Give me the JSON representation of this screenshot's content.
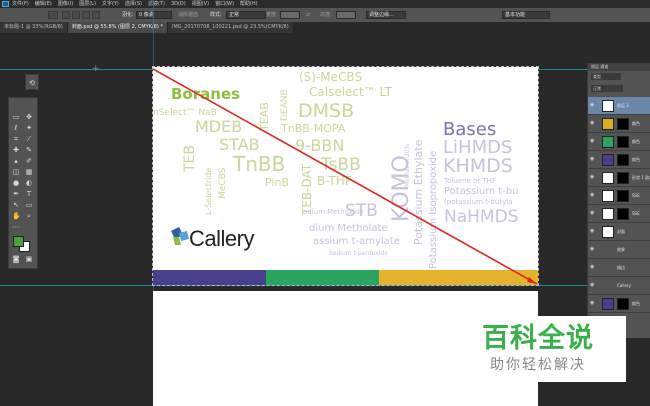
{
  "menu": {
    "items": [
      "文件(F)",
      "编辑(E)",
      "图像(I)",
      "图层(L)",
      "文字(Y)",
      "选择(S)",
      "滤镜(T)",
      "3D(D)",
      "视图(V)",
      "窗口(W)",
      "帮助(H)"
    ]
  },
  "tabs": [
    {
      "label": "未标题-1 @ 33%(RGB/8)",
      "active": false
    },
    {
      "label": "封面.psd @ 55.8% (图层 2, CMYK/8) *",
      "active": true
    },
    {
      "label": "IMG_20170708_100221.psd @ 23.5%(CMYK/8)",
      "active": false
    }
  ],
  "options": {
    "feather_label": "羽化:",
    "feather_value": "0 像素",
    "antialias_label": "消除锯齿",
    "style_label": "样式:",
    "style_value": "正常",
    "width_label": "宽度:",
    "height_label": "高度:",
    "refine_button": "调整边缘...",
    "workspace": "基本功能"
  },
  "canvas": {
    "logo_text": "Callery",
    "words": [
      {
        "text": "Boranes",
        "color": "#8cbf3f"
      },
      {
        "text": "(S)-MeCBS",
        "color": "#c8d89a"
      },
      {
        "text": "Calselect™ LT",
        "color": "#c8d89a"
      },
      {
        "text": "DMSB",
        "color": "#c8d89a"
      },
      {
        "text": "MDEB",
        "color": "#c8d89a"
      },
      {
        "text": "TnBB-MOPA",
        "color": "#c8d89a"
      },
      {
        "text": "STAB",
        "color": "#c8d89a"
      },
      {
        "text": "9-BBN",
        "color": "#c8d89a"
      },
      {
        "text": "TnBB",
        "color": "#c8d89a"
      },
      {
        "text": "TsBB",
        "color": "#c8d89a"
      },
      {
        "text": "TEB",
        "color": "#c8d89a"
      },
      {
        "text": "PinB",
        "color": "#c8d89a"
      },
      {
        "text": "B-THF",
        "color": "#c8d89a"
      },
      {
        "text": "TEAB",
        "color": "#c8d89a"
      },
      {
        "text": "DEANB",
        "color": "#c8d89a"
      },
      {
        "text": "nSelect™ NaB",
        "color": "#c8d89a"
      },
      {
        "text": "L-Selectride",
        "color": "#c8d89a"
      },
      {
        "text": "MeCBS",
        "color": "#c8d89a"
      },
      {
        "text": "TEB-DAT",
        "color": "#c8d89a"
      },
      {
        "text": "Bases",
        "color": "#7e72ad"
      },
      {
        "text": "LiHMDS",
        "color": "#c8c2dc"
      },
      {
        "text": "KHMDS",
        "color": "#c8c2dc"
      },
      {
        "text": "Toluene or THF",
        "color": "#c8c2dc"
      },
      {
        "text": "Potassium t-bu",
        "color": "#c8c2dc"
      },
      {
        "text": "(potassium t-butyla",
        "color": "#c8c2dc"
      },
      {
        "text": "NaHMDS",
        "color": "#c8c2dc"
      },
      {
        "text": "STB",
        "color": "#c8c2dc"
      },
      {
        "text": "KOMO",
        "color": "#c8c2dc"
      },
      {
        "text": "Potassium Ethylate",
        "color": "#c8c2dc"
      },
      {
        "text": "Potassium Isopropoxide",
        "color": "#c8c2dc"
      },
      {
        "text": "odium Methoxide",
        "color": "#c8c2dc"
      },
      {
        "text": "dium Metholate",
        "color": "#c8c2dc"
      },
      {
        "text": "assium t-amylate",
        "color": "#c8c2dc"
      },
      {
        "text": "Sodium t-pentoxide",
        "color": "#c8c2dc"
      },
      {
        "text": "Methanol 30%",
        "color": "#c8c2dc"
      }
    ],
    "bar_colors": [
      "#4a3f8c",
      "#2aa35f",
      "#e4b22c",
      "#e4b22c"
    ]
  },
  "layers": {
    "tabs_label": "图层  通道",
    "kind_label": "类型",
    "blend_mode": "正常",
    "rows": [
      {
        "name": "图层 2",
        "thumb": "#ffffff",
        "mask": false,
        "selected": true
      },
      {
        "name": "颜色",
        "thumb": "#d8b020",
        "mask": true,
        "selected": false
      },
      {
        "name": "颜色",
        "thumb": "#2aa35f",
        "mask": true,
        "selected": false
      },
      {
        "name": "颜色",
        "thumb": "#4a3f8c",
        "mask": true,
        "selected": false
      },
      {
        "name": "形状 1 副本",
        "thumb": "#ffffff",
        "mask": true,
        "selected": false
      },
      {
        "name": "SSE",
        "thumb": "#ffffff",
        "mask": true,
        "selected": false
      },
      {
        "name": "SSE",
        "thumb": "#ffffff",
        "mask": true,
        "selected": false
      },
      {
        "name": "封面",
        "thumb": "#ffffff",
        "mask": false,
        "selected": false
      },
      {
        "name": "效果",
        "thumb": "",
        "mask": false,
        "selected": false
      },
      {
        "name": "描边",
        "thumb": "",
        "mask": false,
        "selected": false
      },
      {
        "name": "Callery",
        "thumb": "",
        "mask": false,
        "selected": false
      },
      {
        "name": "颜色",
        "thumb": "#4a3f8c",
        "mask": true,
        "selected": false
      }
    ]
  },
  "watermark": {
    "title": "百科全说",
    "subtitle": "助你轻松解决"
  }
}
